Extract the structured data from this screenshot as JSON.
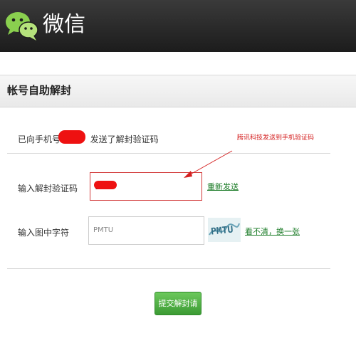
{
  "app": {
    "name": "微信"
  },
  "section": {
    "title": "帐号自助解封"
  },
  "info": {
    "text_prefix": "已向手机号1",
    "text_suffix": "发送了解封验证码"
  },
  "annotation": {
    "text": "腾讯科技发送到手机验证码",
    "color": "#d42020"
  },
  "form": {
    "code_label": "输入解封验证码",
    "code_value": "1",
    "resend_link": "重新发送",
    "char_label": "输入图中字符",
    "char_value": "PMTU",
    "refresh_link": "看不清，换一张",
    "captcha_text": "PMTU"
  },
  "submit": {
    "label": "提交解封请求"
  },
  "colors": {
    "topbar": "#1c1c1c",
    "link": "#1a7b26",
    "button": "#3c9b34",
    "highlight": "#d42020"
  }
}
